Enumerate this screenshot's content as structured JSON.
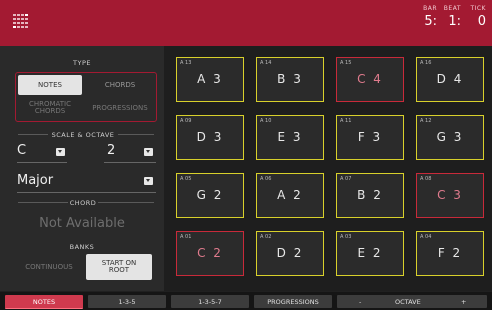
{
  "header": {
    "bar_label": "BAR",
    "bar_value": "5:",
    "beat_label": "BEAT",
    "beat_value": "1:",
    "tick_label": "TICK",
    "tick_value": "0"
  },
  "left": {
    "type_title": "TYPE",
    "type_notes": "NOTES",
    "type_chords": "CHORDS",
    "type_chromatic": "CHROMATIC CHORDS",
    "type_progressions": "PROGRESSIONS",
    "scale_title": "SCALE & OCTAVE",
    "root_value": "C",
    "octave_value": "2",
    "scale_value": "Major",
    "chord_title": "CHORD",
    "chord_value": "Not Available",
    "banks_title": "BANKS",
    "banks_continuous": "CONTINUOUS",
    "banks_start_on_root": "START ON ROOT"
  },
  "pads": [
    {
      "id": "A 13",
      "note": "A 3",
      "root": false
    },
    {
      "id": "A 14",
      "note": "B 3",
      "root": false
    },
    {
      "id": "A 15",
      "note": "C 4",
      "root": true
    },
    {
      "id": "A 16",
      "note": "D 4",
      "root": false
    },
    {
      "id": "A 09",
      "note": "D 3",
      "root": false
    },
    {
      "id": "A 10",
      "note": "E 3",
      "root": false
    },
    {
      "id": "A 11",
      "note": "F 3",
      "root": false
    },
    {
      "id": "A 12",
      "note": "G 3",
      "root": false
    },
    {
      "id": "A 05",
      "note": "G 2",
      "root": false
    },
    {
      "id": "A 06",
      "note": "A 2",
      "root": false
    },
    {
      "id": "A 07",
      "note": "B 2",
      "root": false
    },
    {
      "id": "A 08",
      "note": "C 3",
      "root": true
    },
    {
      "id": "A 01",
      "note": "C 2",
      "root": true
    },
    {
      "id": "A 02",
      "note": "D 2",
      "root": false
    },
    {
      "id": "A 03",
      "note": "E 2",
      "root": false
    },
    {
      "id": "A 04",
      "note": "F 2",
      "root": false
    }
  ],
  "bottom": {
    "notes": "NOTES",
    "chord_135": "1-3-5",
    "chord_1357": "1-3-5-7",
    "progressions": "PROGRESSIONS",
    "octave_minus": "-",
    "octave_label": "OCTAVE",
    "octave_plus": "+"
  },
  "colors": {
    "accent": "#a31a32",
    "pad_border": "#d8d02b",
    "root_border": "#c82a3a"
  }
}
